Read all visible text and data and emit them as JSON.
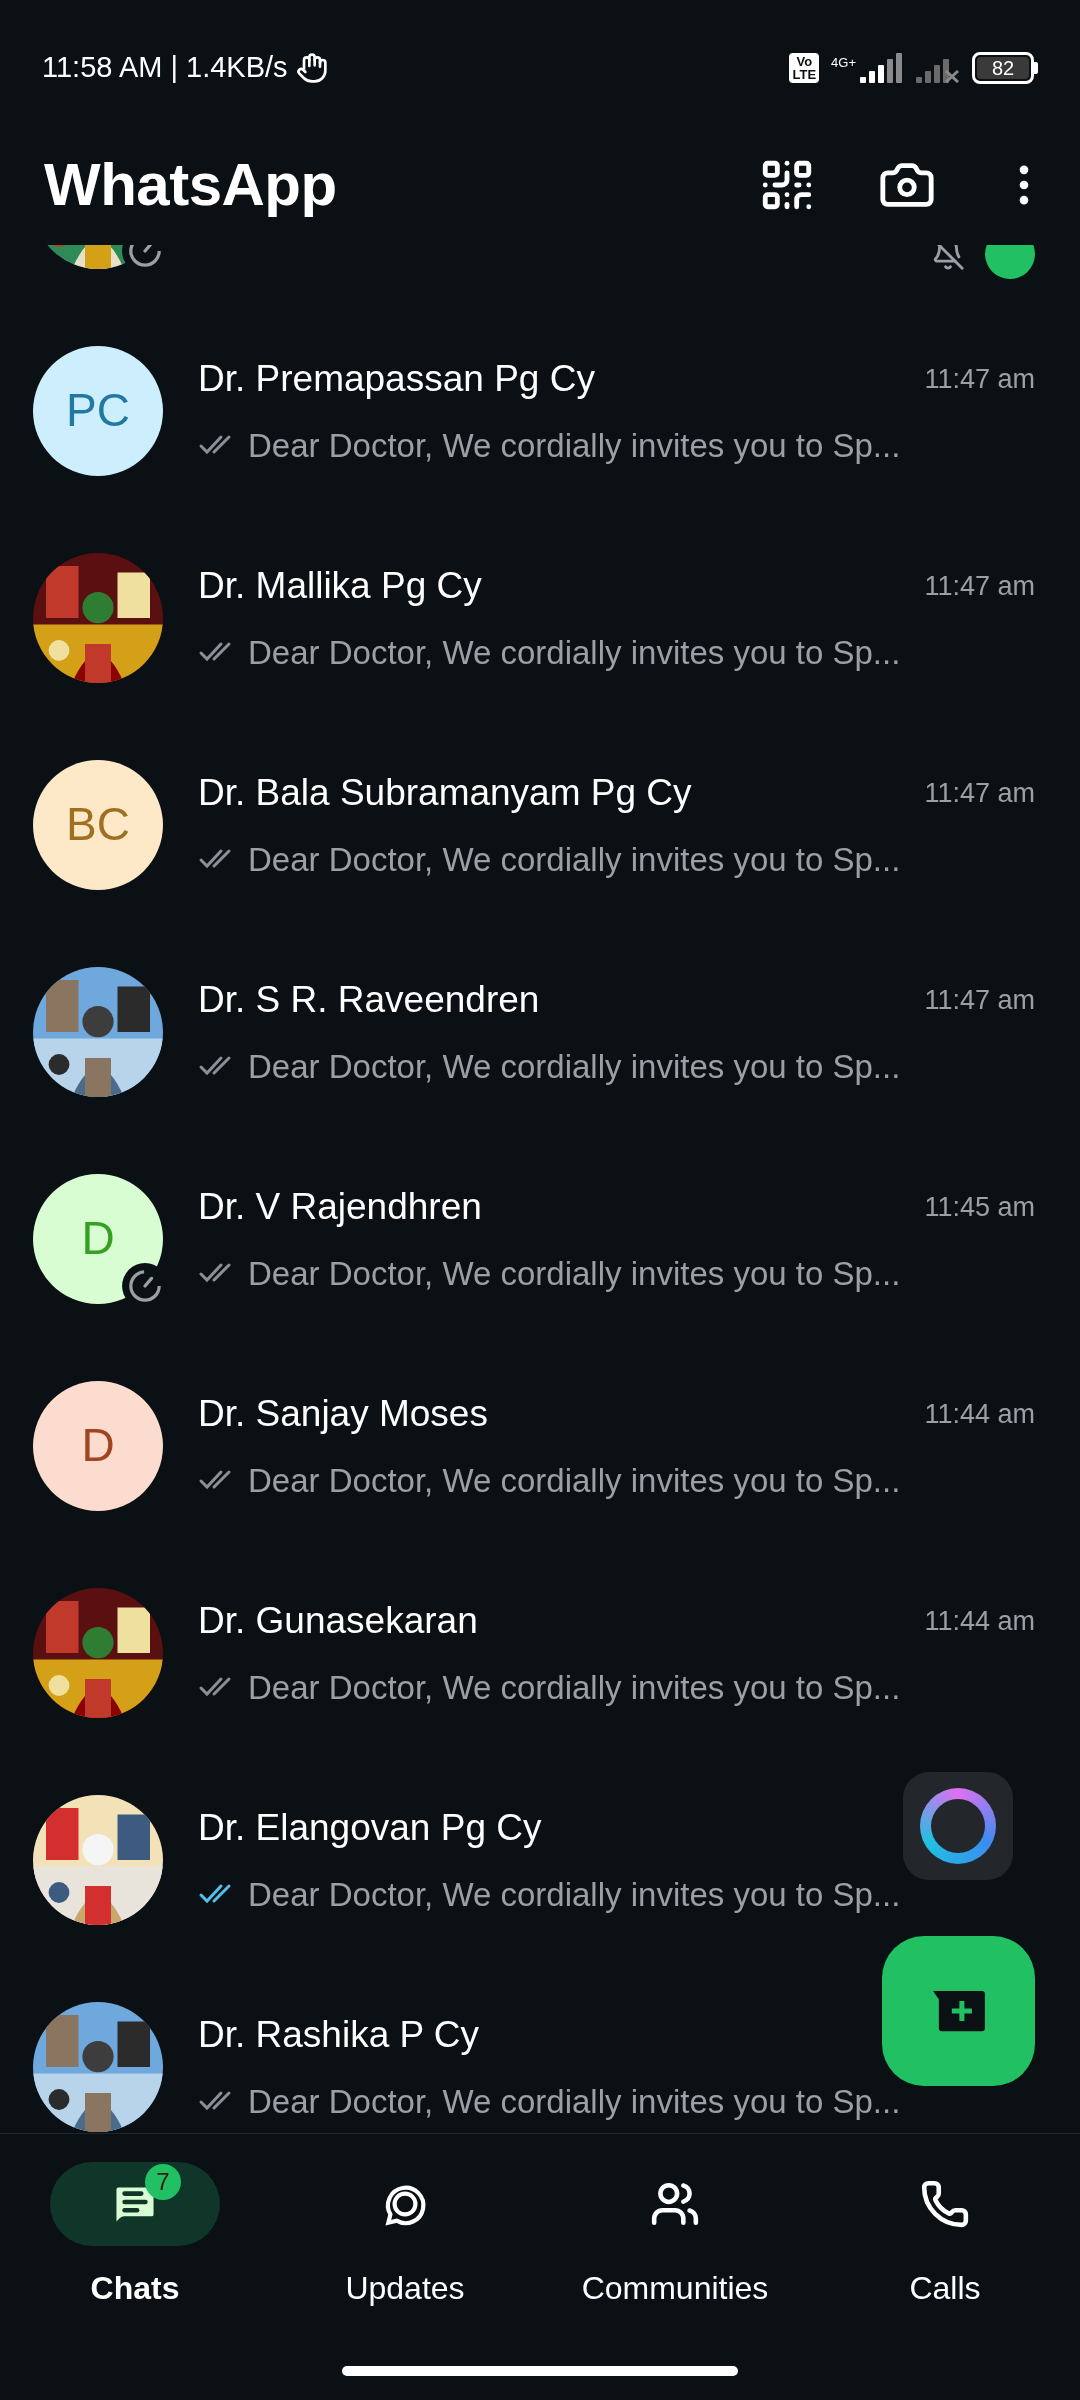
{
  "status_bar": {
    "time": "11:58 AM | 1.4KB/s",
    "volte": [
      "Vo",
      "LTE"
    ],
    "network": "4G+",
    "battery": "82"
  },
  "app_bar": {
    "title": "WhatsApp"
  },
  "chats": [
    {
      "status_badge": true,
      "unread": true
    },
    {
      "name": "Dr. Premapassan Pg Cy",
      "message": "Dear  Doctor,  We cordially invites you to Sp...",
      "time": "11:47 am",
      "read": false,
      "avatar": {
        "kind": "initials",
        "initials": "PC",
        "color": "#cdeefd"
      }
    },
    {
      "name": "Dr. Mallika Pg Cy",
      "message": "Dear  Doctor,  We cordially invites you to Sp...",
      "time": "11:47 am",
      "read": false
    },
    {
      "name": "Dr. Bala Subramanyam Pg Cy",
      "message": "Dear  Doctor,  We cordially invites you to Sp...",
      "time": "11:47 am",
      "read": false,
      "avatar": {
        "kind": "initials",
        "initials": "BC",
        "color": "#fde9c8"
      }
    },
    {
      "name": "Dr. S R. Raveendren",
      "message": "Dear  Doctor,  We cordially invites you to Sp...",
      "time": "11:47 am",
      "read": false
    },
    {
      "name": "Dr. V Rajendhren",
      "message": "Dear  Doctor,  We cordially invites you to Sp...",
      "time": "11:45 am",
      "read": false,
      "status_badge": true,
      "avatar": {
        "kind": "initials",
        "initials": "D",
        "color": "#d9fdd3"
      }
    },
    {
      "name": "Dr. Sanjay Moses",
      "message": "Dear  Doctor,  We cordially invites you to Sp...",
      "time": "11:44 am",
      "read": false,
      "avatar": {
        "kind": "initials",
        "initials": "D",
        "color": "#fddcd0"
      }
    },
    {
      "name": "Dr. Gunasekaran",
      "message": "Dear  Doctor,  We cordially invites you to Sp...",
      "time": "11:44 am",
      "read": false
    },
    {
      "name": "Dr. Elangovan Pg Cy",
      "message": "Dear  Doctor,  We cordially invites you to Sp...",
      "read": true
    },
    {
      "name": "Dr. Rashika P Cy",
      "message": "Dear  Doctor,  We cordially invites you to Sp...",
      "read": false
    }
  ],
  "nav": [
    {
      "label": "Chats",
      "selected": true,
      "badge": "7"
    },
    {
      "label": "Updates",
      "selected": false
    },
    {
      "label": "Communities",
      "selected": false
    },
    {
      "label": "Calls",
      "selected": false
    }
  ]
}
